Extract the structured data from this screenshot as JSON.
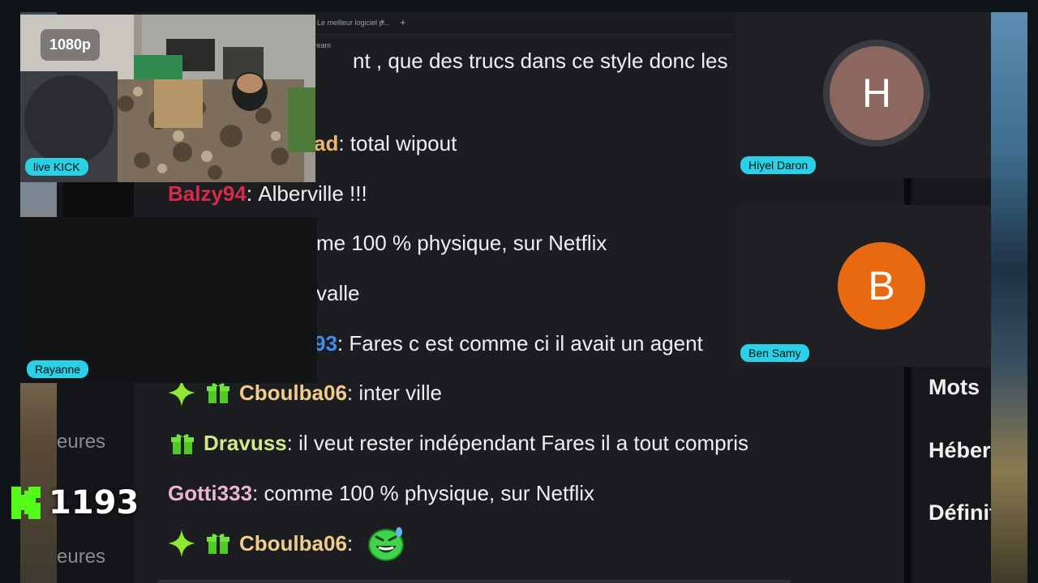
{
  "webcam": {
    "quality_badge": "1080p",
    "source_label": "live KICK"
  },
  "guest_labels": {
    "left_guest": "Rayanne"
  },
  "participants": [
    {
      "initial": "H",
      "name": "Hiyel Daron",
      "color": "#8b6760"
    },
    {
      "initial": "B",
      "name": "Ben Samy",
      "color": "#e8690f"
    }
  ],
  "browser_tab": {
    "title": "Le meilleur logiciel p...",
    "close": "×",
    "new_tab": "+",
    "address_fragment": "tream"
  },
  "chat": {
    "messages": [
      {
        "user": "",
        "user_color": "#efeff1",
        "text": "nt , que des trucs dans ce style donc les"
      },
      {
        "user": "ad",
        "user_color": "#e9b66f",
        "text": "total wipout"
      },
      {
        "user": "Balzy94",
        "user_color": "#d62c4c",
        "text": "Alberville !!!"
      },
      {
        "user": "",
        "user_color": "#efeff1",
        "text": "me 100 % physique, sur Netflix"
      },
      {
        "user": "",
        "user_color": "#efeff1",
        "text": "valle"
      },
      {
        "user": "93",
        "user_color": "#3f8ef0",
        "text": "Fares c est comme ci il avait un agent"
      },
      {
        "user": "Cboulba06",
        "user_color": "#f2cc8a",
        "text": "inter ville"
      },
      {
        "user": "Dravuss",
        "user_color": "#d3e88a",
        "text": "il veut rester indépendant Fares il a tout compris"
      },
      {
        "user": "Gotti333",
        "user_color": "#eab6c8",
        "text": "comme 100 % physique, sur Netflix"
      },
      {
        "user": "Cboulba06",
        "user_color": "#f2cc8a",
        "text": ""
      }
    ]
  },
  "right_panel": {
    "items": [
      "Mots",
      "Hébergement",
      "Définitions"
    ]
  },
  "left_panel": {
    "items": [
      "eures",
      "eures"
    ]
  },
  "viewers": {
    "count": "1193",
    "platform_icon": "kick-logo-icon"
  },
  "colors": {
    "accent_label": "#29d0e6",
    "kick_green": "#53fc18",
    "chat_bg": "#1c1d20"
  }
}
